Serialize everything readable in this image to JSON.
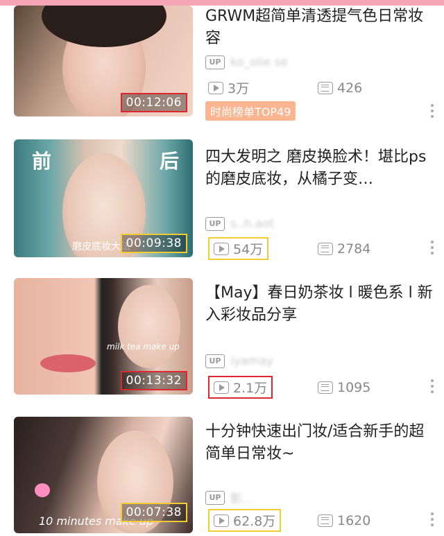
{
  "videos": [
    {
      "title": "GRWM超简单清透提气色日常妆容",
      "uploader": "ko_olie se",
      "duration": "00:12:06",
      "views": "3万",
      "comments": "426",
      "tag": "时尚榜单TOP49"
    },
    {
      "title": "四大发明之  磨皮换脸术！堪比ps的磨皮底妆，从橘子变…",
      "uploader": "s..h.aot",
      "duration": "00:09:38",
      "views": "54万",
      "comments": "2784",
      "overlay_before": "前",
      "overlay_after": "后",
      "overlay_caption": "磨皮底妆大法"
    },
    {
      "title": "【May】春日奶茶妆 l 暖色系 l 新入彩妆品分享",
      "uploader": "iyamay",
      "duration": "00:13:32",
      "views": "2.1万",
      "comments": "1095",
      "overlay_caption": "milk tea make up"
    },
    {
      "title": "十分钟快速出门妆/适合新手的超简单日常妆~",
      "uploader": "影...",
      "duration": "00:07:38",
      "views": "62.8万",
      "comments": "1620",
      "overlay_caption": "10 minutes make up"
    }
  ],
  "labels": {
    "up_badge": "UP"
  },
  "icons": {
    "views": "play-count-icon",
    "comments": "comment-icon",
    "more": "more-vertical-icon"
  },
  "colors": {
    "top_bar": "#f4a6b6",
    "highlight_red": "#e0262d",
    "highlight_yellow": "#f2cc30",
    "tag_bg": "#fbb591"
  }
}
